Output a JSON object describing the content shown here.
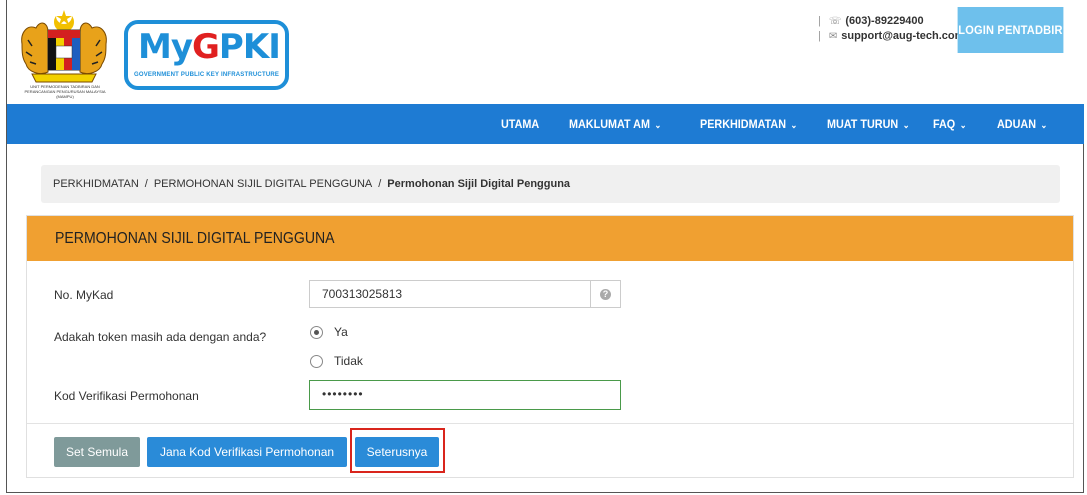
{
  "header": {
    "coat_caption": "UNIT PERMODENAN TADBIRAN DAN PERANCANGAN PENGURUSAN MALAYSIA (MAMPU)",
    "logo": {
      "main": "MyGPKI",
      "subtitle": "GOVERNMENT PUBLIC KEY INFRASTRUCTURE"
    },
    "contact": {
      "phone": "(603)-89229400",
      "email": "support@aug-tech.com"
    },
    "login_label": "LOGIN PENTADBIR"
  },
  "nav": {
    "items": [
      {
        "label": "UTAMA",
        "has_dropdown": false
      },
      {
        "label": "MAKLUMAT AM",
        "has_dropdown": true
      },
      {
        "label": "PERKHIDMATAN",
        "has_dropdown": true
      },
      {
        "label": "MUAT TURUN",
        "has_dropdown": true
      },
      {
        "label": "FAQ",
        "has_dropdown": true
      },
      {
        "label": "ADUAN",
        "has_dropdown": true
      }
    ]
  },
  "breadcrumb": {
    "items": [
      "PERKHIDMATAN",
      "PERMOHONAN SIJIL DIGITAL PENGGUNA"
    ],
    "current": "Permohonan Sijil Digital Pengguna",
    "separator": "/"
  },
  "form": {
    "title": "PERMOHONAN SIJIL DIGITAL PENGGUNA",
    "mykad_label": "No. MyKad",
    "mykad_value": "700313025813",
    "token_question": "Adakah token masih ada dengan anda?",
    "token_options": [
      {
        "label": "Ya",
        "selected": true
      },
      {
        "label": "Tidak",
        "selected": false
      }
    ],
    "verification_label": "Kod Verifikasi Permohonan",
    "verification_value": "••••••••"
  },
  "buttons": {
    "reset": "Set Semula",
    "generate_code": "Jana Kod Verifikasi Permohonan",
    "next": "Seterusnya"
  },
  "colors": {
    "nav_bg": "#1e7bd3",
    "panel_header": "#f0a031",
    "login_button": "#6ec0ec",
    "primary_button": "#2a8bd8",
    "reset_button": "#7f9a9a",
    "highlight_border": "#d9251c",
    "valid_input_border": "#4a9a4a"
  }
}
